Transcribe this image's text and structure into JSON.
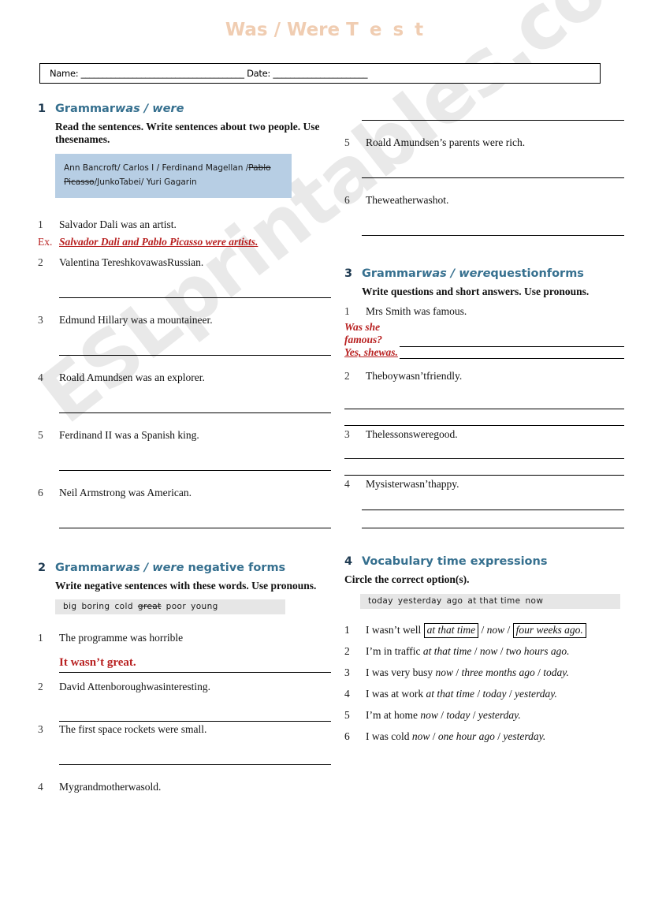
{
  "worksheet": {
    "title_main": "Was / Were ",
    "title_spaced": "T e s t",
    "title_color": "#f0cdb2",
    "name_date_line": "Name: ______________________________________ Date: ______________________",
    "watermark": "ESLprintables.com"
  },
  "exercise1": {
    "number": "1",
    "heading_plain": "Grammar",
    "heading_italic": "was / were",
    "instruction": "Read the sentences. Write sentences about two people. Use thesenames.",
    "wordbox": {
      "part1": "Ann Bancroft/ Carlos I  /  Ferdinand Magellan /",
      "struck": "Pablo Picasso",
      "part2": "/JunkoTabei/ Yuri Gagarin"
    },
    "items": [
      {
        "num": "1",
        "text": "Salvador Dali was an artist."
      },
      {
        "num": "2",
        "text": "Valentina TereshkovawasRussian."
      },
      {
        "num": "3",
        "text": "Edmund Hillary was a mountaineer."
      },
      {
        "num": "4",
        "text": "Roald Amundsen was an explorer."
      },
      {
        "num": "5",
        "text": "Ferdinand II was a Spanish king."
      },
      {
        "num": "6",
        "text": "Neil Armstrong was American."
      },
      {
        "num": "5",
        "text": "Roald Amundsen’s parents were rich."
      },
      {
        "num": "6",
        "text": "Theweatherwashot."
      }
    ],
    "example_label": "Ex.",
    "example_answer": "Salvador Dali and Pablo Picasso were artists."
  },
  "exercise2": {
    "number": "2",
    "heading_plain": "Grammar",
    "heading_italic": "was / were",
    "heading_tail": " negative forms",
    "instruction": "Write negative sentences with these words. Use pronouns.",
    "wordbank": [
      "big",
      "boring",
      "cold",
      "great",
      "poor",
      "young"
    ],
    "wordbank_struck": "great",
    "items": [
      {
        "num": "1",
        "text": "The programme was horrible"
      },
      {
        "num": "2",
        "text": "David Attenboroughwasinteresting."
      },
      {
        "num": "3",
        "text": "The first space rockets were small."
      },
      {
        "num": "4",
        "text": "Mygrandmotherwasold."
      }
    ],
    "example_answer": "It wasn’t great."
  },
  "exercise3": {
    "number": "3",
    "heading_plain": "Grammar",
    "heading_italic": "was / were",
    "heading_tail": "questionforms",
    "instruction": "Write questions and short answers. Use pronouns.",
    "items": [
      {
        "num": "1",
        "text": "Mrs Smith was famous."
      },
      {
        "num": "2",
        "text": "Theboywasn’tfriendly."
      },
      {
        "num": "3",
        "text": "Thelessonsweregood."
      },
      {
        "num": "4",
        "text": "Mysisterwasn’thappy."
      }
    ],
    "example_question_line1": "Was she",
    "example_question_line2": "famous?",
    "example_answer": "Yes, shewas."
  },
  "exercise4": {
    "number": "4",
    "heading": "Vocabulary time expressions",
    "instruction": "Circle the correct option(s).",
    "wordbank": [
      "today",
      "yesterday",
      "ago",
      "at that time",
      "now"
    ],
    "items": [
      {
        "num": "1",
        "lead": "I wasn’t well ",
        "options": [
          "at that time",
          "now",
          "four weeks ago."
        ],
        "circled": [
          true,
          false,
          true
        ]
      },
      {
        "num": "2",
        "lead": "I’m in traffic ",
        "options": [
          "at that time",
          "now",
          "two hours ago."
        ],
        "circled": [
          false,
          false,
          false
        ]
      },
      {
        "num": "3",
        "lead": "I was very busy ",
        "options": [
          "now",
          "three months ago",
          "today."
        ],
        "circled": [
          false,
          false,
          false
        ]
      },
      {
        "num": "4",
        "lead": "I was at work ",
        "options": [
          "at that time",
          "today",
          "yesterday."
        ],
        "circled": [
          false,
          false,
          false
        ]
      },
      {
        "num": "5",
        "lead": "I’m at home ",
        "options": [
          "now",
          "today",
          "yesterday."
        ],
        "circled": [
          false,
          false,
          false
        ]
      },
      {
        "num": "6",
        "lead": "I was cold ",
        "options": [
          "now",
          "one hour ago",
          "yesterday."
        ],
        "circled": [
          false,
          false,
          false
        ]
      }
    ]
  }
}
